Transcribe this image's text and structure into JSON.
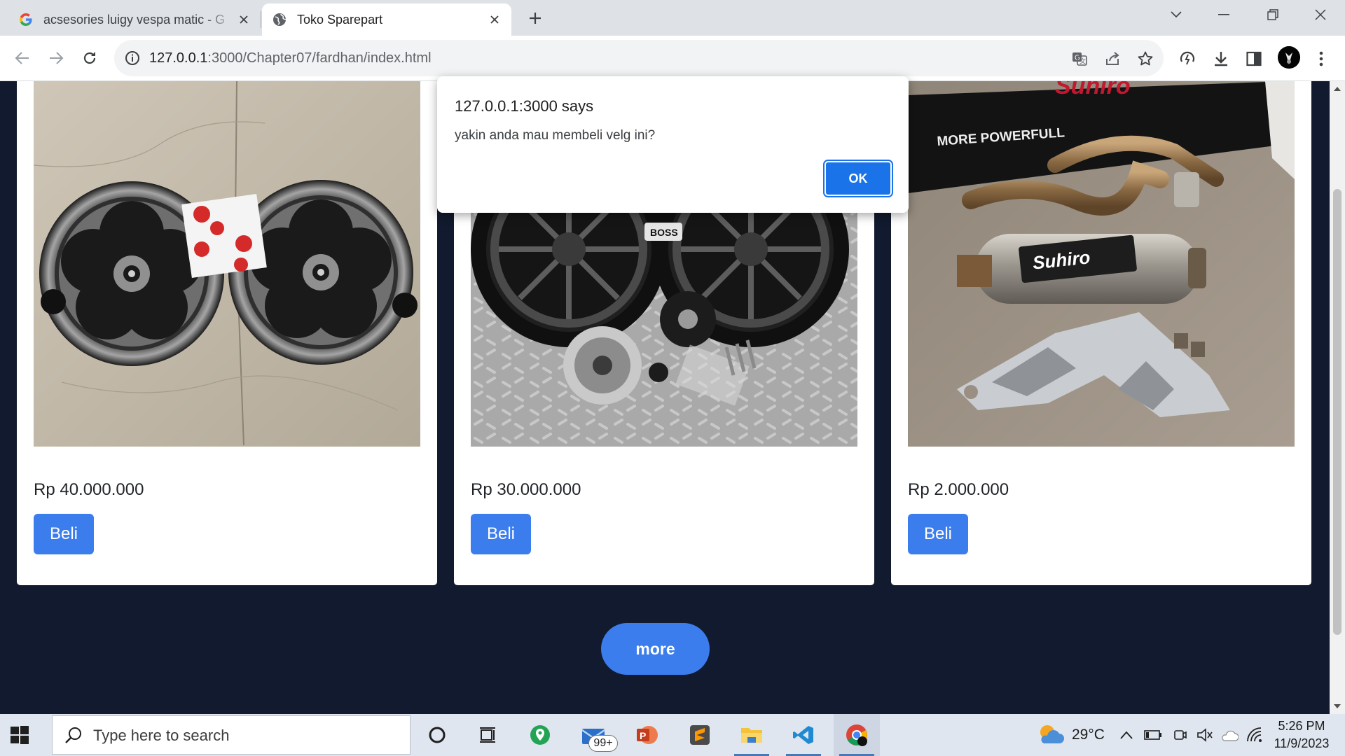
{
  "browser": {
    "tabs": [
      {
        "title": "acsesories luigy vespa matic - G",
        "favicon": "google-g-icon",
        "active": false
      },
      {
        "title": "Toko Sparepart",
        "favicon": "globe-icon",
        "active": true
      }
    ],
    "address": {
      "host": "127.0.0.1",
      "path": ":3000/Chapter07/fardhan/index.html"
    }
  },
  "page": {
    "products": [
      {
        "image": "black-silver-five-hole-vespa-wheels-photo",
        "price": "Rp 40.000.000",
        "buy_label": "Beli"
      },
      {
        "image": "black-boss-multi-spoke-wheels-photo",
        "price": "Rp 30.000.000",
        "buy_label": "Beli"
      },
      {
        "image": "suhiro-exhaust-muffler-kit-photo",
        "price": "Rp 2.000.000",
        "buy_label": "Beli"
      }
    ],
    "more_label": "more",
    "box_text": "MORE POWERFULL"
  },
  "dialog": {
    "title": "127.0.0.1:3000 says",
    "message": "yakin anda mau membeli velg ini?",
    "ok_label": "OK"
  },
  "taskbar": {
    "search_placeholder": "Type here to search",
    "mail_badge": "99+",
    "weather_temp": "29°C",
    "time": "5:26 PM",
    "date": "11/9/2023"
  },
  "colors": {
    "page_bg": "#111a2e",
    "accent_button": "#3b7ded",
    "dialog_ok": "#1a73e8"
  }
}
